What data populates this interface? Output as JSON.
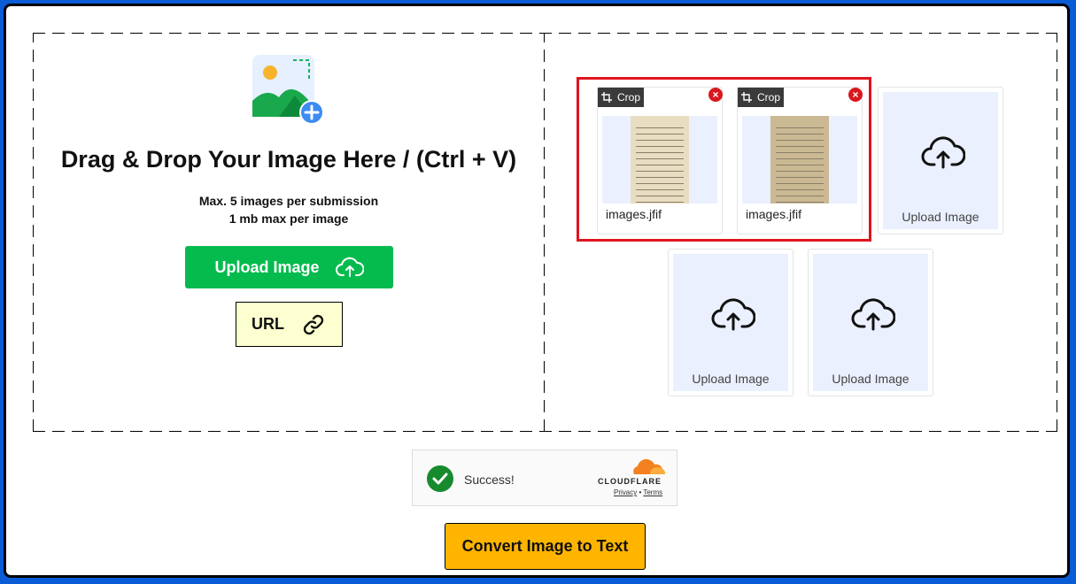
{
  "dropzone": {
    "headline": "Drag & Drop Your Image Here / (Ctrl + V)",
    "limit_line1": "Max. 5 images per submission",
    "limit_line2": "1 mb max per image",
    "upload_label": "Upload Image",
    "url_label": "URL"
  },
  "uploads": {
    "thumbnails": [
      {
        "crop_label": "Crop",
        "filename": "images.jfif"
      },
      {
        "crop_label": "Crop",
        "filename": "images.jfif"
      }
    ],
    "placeholders": [
      {
        "label": "Upload Image"
      },
      {
        "label": "Upload Image"
      },
      {
        "label": "Upload Image"
      }
    ]
  },
  "captcha": {
    "status": "Success!",
    "brand": "CLOUDFLARE",
    "privacy": "Privacy",
    "separator": "•",
    "terms": "Terms"
  },
  "action": {
    "convert_label": "Convert Image to Text"
  },
  "colors": {
    "upload_green": "#06bb4e",
    "convert_yellow": "#ffb500",
    "url_bg": "#fcffcf",
    "highlight_red": "#e0141e",
    "placeholder_bg": "#ebf0ff"
  }
}
